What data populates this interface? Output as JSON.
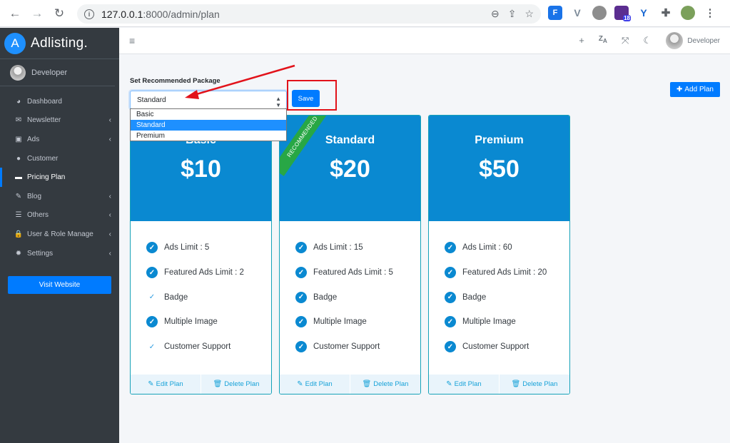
{
  "browser": {
    "url_host": "127.0.0.1",
    "url_path": ":8000/admin/plan",
    "extension_badge": "18"
  },
  "sidebar": {
    "brand_letter": "A",
    "brand_name": "Adlisting.",
    "user_name": "Developer",
    "items": [
      {
        "label": "Dashboard",
        "icon": "tachometer-icon",
        "glyph": "◕",
        "has_arrow": false
      },
      {
        "label": "Newsletter",
        "icon": "envelope-icon",
        "glyph": "✉",
        "has_arrow": true
      },
      {
        "label": "Ads",
        "icon": "ad-icon",
        "glyph": "▣",
        "has_arrow": true
      },
      {
        "label": "Customer",
        "icon": "user-icon",
        "glyph": "●",
        "has_arrow": false
      },
      {
        "label": "Pricing Plan",
        "icon": "credit-card-icon",
        "glyph": "▬",
        "has_arrow": false,
        "active": true
      },
      {
        "label": "Blog",
        "icon": "blog-icon",
        "glyph": "✎",
        "has_arrow": true
      },
      {
        "label": "Others",
        "icon": "list-icon",
        "glyph": "☰",
        "has_arrow": true
      },
      {
        "label": "User & Role Manage",
        "icon": "lock-icon",
        "glyph": "🔒",
        "has_arrow": true
      },
      {
        "label": "Settings",
        "icon": "cog-icon",
        "glyph": "✹",
        "has_arrow": true
      }
    ],
    "visit_label": "Visit Website"
  },
  "topbar": {
    "user_name": "Developer"
  },
  "content": {
    "set_label": "Set Recommended Package",
    "selected_value": "Standard",
    "options": [
      "Basic",
      "Standard",
      "Premium"
    ],
    "save_label": "Save",
    "add_plan_label": "Add Plan",
    "ribbon_label": "RECOMMENDED",
    "edit_label": "Edit Plan",
    "delete_label": "Delete Plan"
  },
  "plans": [
    {
      "name": "Basic",
      "price": "$10",
      "features": [
        {
          "label": "Ads Limit : 5",
          "checked": true
        },
        {
          "label": "Featured Ads Limit : 2",
          "checked": true
        },
        {
          "label": "Badge",
          "checked": false
        },
        {
          "label": "Multiple Image",
          "checked": true
        },
        {
          "label": "Customer Support",
          "checked": false
        }
      ]
    },
    {
      "name": "Standard",
      "price": "$20",
      "recommended": true,
      "features": [
        {
          "label": "Ads Limit : 15",
          "checked": true
        },
        {
          "label": "Featured Ads Limit : 5",
          "checked": true
        },
        {
          "label": "Badge",
          "checked": true
        },
        {
          "label": "Multiple Image",
          "checked": true
        },
        {
          "label": "Customer Support",
          "checked": true
        }
      ]
    },
    {
      "name": "Premium",
      "price": "$50",
      "features": [
        {
          "label": "Ads Limit : 60",
          "checked": true
        },
        {
          "label": "Featured Ads Limit : 20",
          "checked": true
        },
        {
          "label": "Badge",
          "checked": true
        },
        {
          "label": "Multiple Image",
          "checked": true
        },
        {
          "label": "Customer Support",
          "checked": true
        }
      ]
    }
  ],
  "colors": {
    "sidebar_bg": "#343a40",
    "primary": "#007bff",
    "card_header": "#0a89d1",
    "ribbon": "#28a745",
    "annotation_red": "#e2121a"
  }
}
